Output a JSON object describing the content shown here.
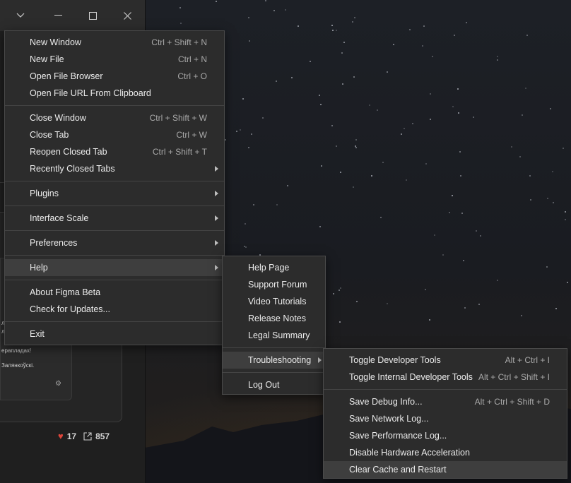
{
  "app": {
    "name": "Figma Beta",
    "window_controls": {
      "menu_icon": "chevron-down-icon",
      "minimize_icon": "minimize-icon",
      "maximize_icon": "maximize-icon",
      "close_icon": "close-icon"
    },
    "background_card": {
      "text_line_1": "ерапладах!",
      "text_line_2": "Залянкоўскі.",
      "text_line_3": "ле",
      "text_line_4": "ла",
      "likes": "17",
      "shares": "857"
    }
  },
  "main_menu": {
    "groups": [
      [
        {
          "label": "New Window",
          "shortcut": "Ctrl + Shift + N"
        },
        {
          "label": "New File",
          "shortcut": "Ctrl + N"
        },
        {
          "label": "Open File Browser",
          "shortcut": "Ctrl + O"
        },
        {
          "label": "Open File URL From Clipboard",
          "shortcut": ""
        }
      ],
      [
        {
          "label": "Close Window",
          "shortcut": "Ctrl + Shift + W"
        },
        {
          "label": "Close Tab",
          "shortcut": "Ctrl + W"
        },
        {
          "label": "Reopen Closed Tab",
          "shortcut": "Ctrl + Shift + T"
        },
        {
          "label": "Recently Closed Tabs",
          "submenu": true
        }
      ],
      [
        {
          "label": "Plugins",
          "submenu": true
        }
      ],
      [
        {
          "label": "Interface Scale",
          "submenu": true
        }
      ],
      [
        {
          "label": "Preferences",
          "submenu": true
        }
      ],
      [
        {
          "label": "Help",
          "submenu": true,
          "active": true
        }
      ],
      [
        {
          "label": "About Figma Beta",
          "shortcut": ""
        },
        {
          "label": "Check for Updates...",
          "shortcut": ""
        }
      ],
      [
        {
          "label": "Exit",
          "shortcut": ""
        }
      ]
    ]
  },
  "help_menu": {
    "groups": [
      [
        {
          "label": "Help Page"
        },
        {
          "label": "Support Forum"
        },
        {
          "label": "Video Tutorials"
        },
        {
          "label": "Release Notes"
        },
        {
          "label": "Legal Summary"
        }
      ],
      [
        {
          "label": "Troubleshooting",
          "submenu": true,
          "active": true
        }
      ],
      [
        {
          "label": "Log Out"
        }
      ]
    ]
  },
  "troubleshooting_menu": {
    "groups": [
      [
        {
          "label": "Toggle Developer Tools",
          "shortcut": "Alt + Ctrl + I"
        },
        {
          "label": "Toggle Internal Developer Tools",
          "shortcut": "Alt + Ctrl + Shift + I"
        }
      ],
      [
        {
          "label": "Save Debug Info...",
          "shortcut": "Alt + Ctrl + Shift + D"
        },
        {
          "label": "Save Network Log...",
          "shortcut": ""
        },
        {
          "label": "Save Performance Log...",
          "shortcut": ""
        },
        {
          "label": "Disable Hardware Acceleration",
          "shortcut": ""
        },
        {
          "label": "Clear Cache and Restart",
          "shortcut": "",
          "hover": true
        }
      ]
    ]
  },
  "colors": {
    "menu_bg": "#2c2c2c",
    "menu_active": "#3e3e3e",
    "heart": "#e0463b"
  }
}
